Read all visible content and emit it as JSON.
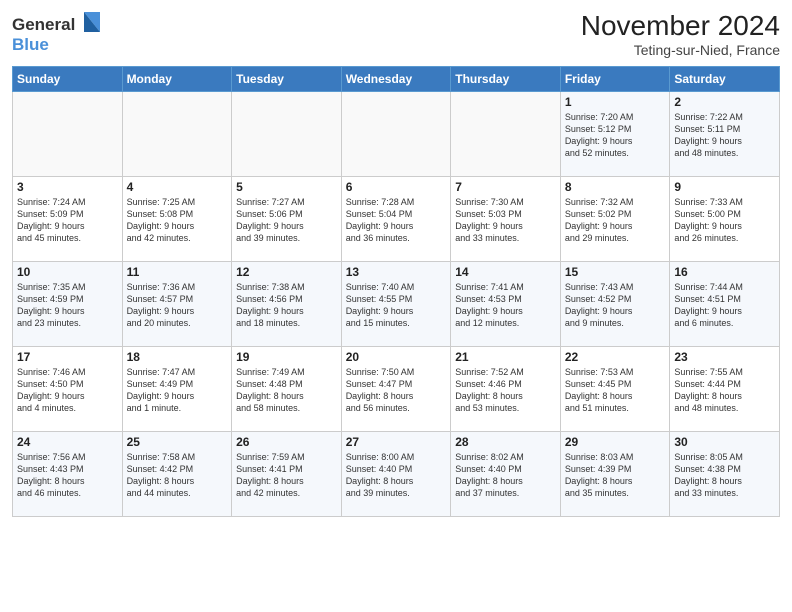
{
  "header": {
    "logo_line1": "General",
    "logo_line2": "Blue",
    "month": "November 2024",
    "location": "Teting-sur-Nied, France"
  },
  "weekdays": [
    "Sunday",
    "Monday",
    "Tuesday",
    "Wednesday",
    "Thursday",
    "Friday",
    "Saturday"
  ],
  "weeks": [
    [
      {
        "day": "",
        "info": ""
      },
      {
        "day": "",
        "info": ""
      },
      {
        "day": "",
        "info": ""
      },
      {
        "day": "",
        "info": ""
      },
      {
        "day": "",
        "info": ""
      },
      {
        "day": "1",
        "info": "Sunrise: 7:20 AM\nSunset: 5:12 PM\nDaylight: 9 hours\nand 52 minutes."
      },
      {
        "day": "2",
        "info": "Sunrise: 7:22 AM\nSunset: 5:11 PM\nDaylight: 9 hours\nand 48 minutes."
      }
    ],
    [
      {
        "day": "3",
        "info": "Sunrise: 7:24 AM\nSunset: 5:09 PM\nDaylight: 9 hours\nand 45 minutes."
      },
      {
        "day": "4",
        "info": "Sunrise: 7:25 AM\nSunset: 5:08 PM\nDaylight: 9 hours\nand 42 minutes."
      },
      {
        "day": "5",
        "info": "Sunrise: 7:27 AM\nSunset: 5:06 PM\nDaylight: 9 hours\nand 39 minutes."
      },
      {
        "day": "6",
        "info": "Sunrise: 7:28 AM\nSunset: 5:04 PM\nDaylight: 9 hours\nand 36 minutes."
      },
      {
        "day": "7",
        "info": "Sunrise: 7:30 AM\nSunset: 5:03 PM\nDaylight: 9 hours\nand 33 minutes."
      },
      {
        "day": "8",
        "info": "Sunrise: 7:32 AM\nSunset: 5:02 PM\nDaylight: 9 hours\nand 29 minutes."
      },
      {
        "day": "9",
        "info": "Sunrise: 7:33 AM\nSunset: 5:00 PM\nDaylight: 9 hours\nand 26 minutes."
      }
    ],
    [
      {
        "day": "10",
        "info": "Sunrise: 7:35 AM\nSunset: 4:59 PM\nDaylight: 9 hours\nand 23 minutes."
      },
      {
        "day": "11",
        "info": "Sunrise: 7:36 AM\nSunset: 4:57 PM\nDaylight: 9 hours\nand 20 minutes."
      },
      {
        "day": "12",
        "info": "Sunrise: 7:38 AM\nSunset: 4:56 PM\nDaylight: 9 hours\nand 18 minutes."
      },
      {
        "day": "13",
        "info": "Sunrise: 7:40 AM\nSunset: 4:55 PM\nDaylight: 9 hours\nand 15 minutes."
      },
      {
        "day": "14",
        "info": "Sunrise: 7:41 AM\nSunset: 4:53 PM\nDaylight: 9 hours\nand 12 minutes."
      },
      {
        "day": "15",
        "info": "Sunrise: 7:43 AM\nSunset: 4:52 PM\nDaylight: 9 hours\nand 9 minutes."
      },
      {
        "day": "16",
        "info": "Sunrise: 7:44 AM\nSunset: 4:51 PM\nDaylight: 9 hours\nand 6 minutes."
      }
    ],
    [
      {
        "day": "17",
        "info": "Sunrise: 7:46 AM\nSunset: 4:50 PM\nDaylight: 9 hours\nand 4 minutes."
      },
      {
        "day": "18",
        "info": "Sunrise: 7:47 AM\nSunset: 4:49 PM\nDaylight: 9 hours\nand 1 minute."
      },
      {
        "day": "19",
        "info": "Sunrise: 7:49 AM\nSunset: 4:48 PM\nDaylight: 8 hours\nand 58 minutes."
      },
      {
        "day": "20",
        "info": "Sunrise: 7:50 AM\nSunset: 4:47 PM\nDaylight: 8 hours\nand 56 minutes."
      },
      {
        "day": "21",
        "info": "Sunrise: 7:52 AM\nSunset: 4:46 PM\nDaylight: 8 hours\nand 53 minutes."
      },
      {
        "day": "22",
        "info": "Sunrise: 7:53 AM\nSunset: 4:45 PM\nDaylight: 8 hours\nand 51 minutes."
      },
      {
        "day": "23",
        "info": "Sunrise: 7:55 AM\nSunset: 4:44 PM\nDaylight: 8 hours\nand 48 minutes."
      }
    ],
    [
      {
        "day": "24",
        "info": "Sunrise: 7:56 AM\nSunset: 4:43 PM\nDaylight: 8 hours\nand 46 minutes."
      },
      {
        "day": "25",
        "info": "Sunrise: 7:58 AM\nSunset: 4:42 PM\nDaylight: 8 hours\nand 44 minutes."
      },
      {
        "day": "26",
        "info": "Sunrise: 7:59 AM\nSunset: 4:41 PM\nDaylight: 8 hours\nand 42 minutes."
      },
      {
        "day": "27",
        "info": "Sunrise: 8:00 AM\nSunset: 4:40 PM\nDaylight: 8 hours\nand 39 minutes."
      },
      {
        "day": "28",
        "info": "Sunrise: 8:02 AM\nSunset: 4:40 PM\nDaylight: 8 hours\nand 37 minutes."
      },
      {
        "day": "29",
        "info": "Sunrise: 8:03 AM\nSunset: 4:39 PM\nDaylight: 8 hours\nand 35 minutes."
      },
      {
        "day": "30",
        "info": "Sunrise: 8:05 AM\nSunset: 4:38 PM\nDaylight: 8 hours\nand 33 minutes."
      }
    ]
  ]
}
